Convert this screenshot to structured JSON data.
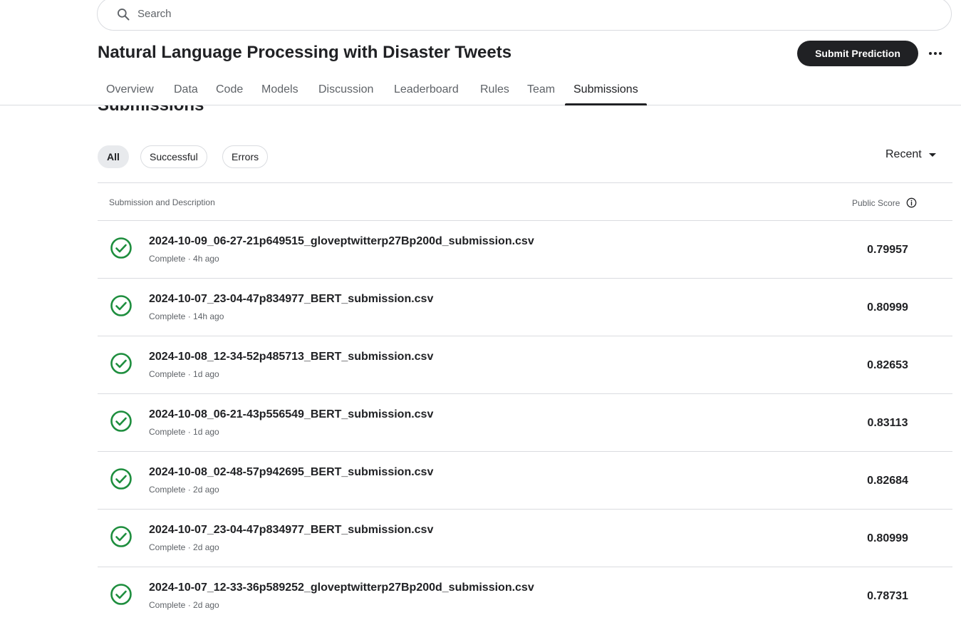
{
  "search": {
    "placeholder": "Search"
  },
  "header": {
    "title": "Natural Language Processing with Disaster Tweets",
    "submit_label": "Submit Prediction"
  },
  "tabs": [
    {
      "label": "Overview"
    },
    {
      "label": "Data"
    },
    {
      "label": "Code"
    },
    {
      "label": "Models"
    },
    {
      "label": "Discussion"
    },
    {
      "label": "Leaderboard"
    },
    {
      "label": "Rules"
    },
    {
      "label": "Team"
    },
    {
      "label": "Submissions",
      "active": true
    }
  ],
  "section": {
    "heading": "Submissions"
  },
  "filters": [
    {
      "label": "All",
      "active": true
    },
    {
      "label": "Successful"
    },
    {
      "label": "Errors"
    }
  ],
  "sort": {
    "label": "Recent"
  },
  "table": {
    "col_description": "Submission and Description",
    "col_score": "Public Score",
    "rows": [
      {
        "file": "2024-10-09_06-27-21p649515_gloveptwitterp27Bp200d_submission.csv",
        "status": "Complete · 4h ago",
        "score": "0.79957"
      },
      {
        "file": "2024-10-07_23-04-47p834977_BERT_submission.csv",
        "status": "Complete · 14h ago",
        "score": "0.80999"
      },
      {
        "file": "2024-10-08_12-34-52p485713_BERT_submission.csv",
        "status": "Complete · 1d ago",
        "score": "0.82653"
      },
      {
        "file": "2024-10-08_06-21-43p556549_BERT_submission.csv",
        "status": "Complete · 1d ago",
        "score": "0.83113"
      },
      {
        "file": "2024-10-08_02-48-57p942695_BERT_submission.csv",
        "status": "Complete · 2d ago",
        "score": "0.82684"
      },
      {
        "file": "2024-10-07_23-04-47p834977_BERT_submission.csv",
        "status": "Complete · 2d ago",
        "score": "0.80999"
      },
      {
        "file": "2024-10-07_12-33-36p589252_gloveptwitterp27Bp200d_submission.csv",
        "status": "Complete · 2d ago",
        "score": "0.78731"
      }
    ]
  },
  "colors": {
    "success": "#1e8e3e",
    "primary": "#202124",
    "border": "#dadce0"
  }
}
